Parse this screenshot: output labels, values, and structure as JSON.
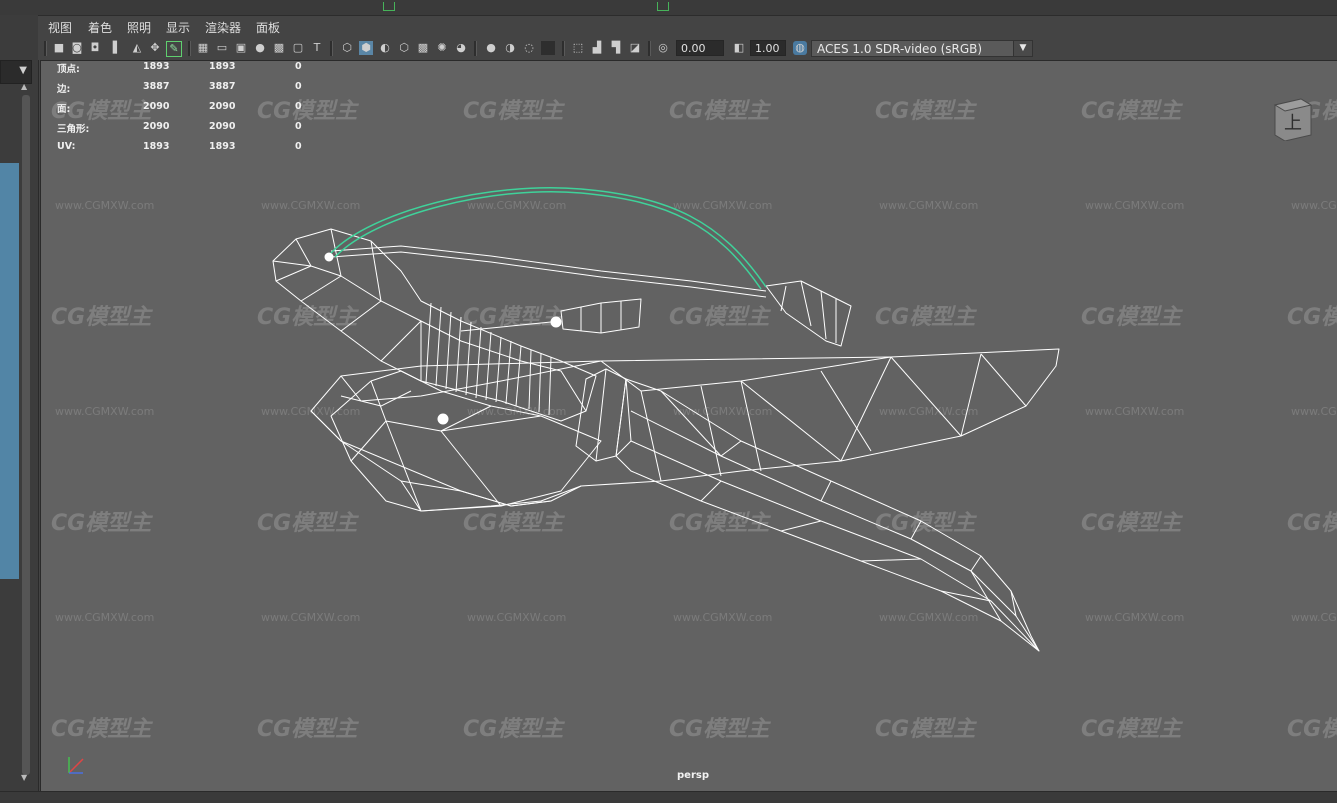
{
  "menu": {
    "items": [
      "视图",
      "着色",
      "照明",
      "显示",
      "渲染器",
      "面板"
    ]
  },
  "toolbar": {
    "exposure_value": "0.00",
    "gamma_value": "1.00",
    "color_management": "ACES 1.0 SDR-video (sRGB)"
  },
  "stats": {
    "rows": [
      {
        "label": "顶点:",
        "a": "1893",
        "b": "1893",
        "c": "0"
      },
      {
        "label": "边:",
        "a": "3887",
        "b": "3887",
        "c": "0"
      },
      {
        "label": "面:",
        "a": "2090",
        "b": "2090",
        "c": "0"
      },
      {
        "label": "三角形:",
        "a": "2090",
        "b": "2090",
        "c": "0"
      },
      {
        "label": "UV:",
        "a": "1893",
        "b": "1893",
        "c": "0"
      }
    ]
  },
  "viewport": {
    "camera_label": "persp",
    "viewcube_label": "上",
    "wire_color": "#ffffff",
    "selected_color": "#3fd29a",
    "background_color": "#626262"
  },
  "watermark": {
    "logo": "CG模型主",
    "url": "www.CGMXW.com"
  }
}
